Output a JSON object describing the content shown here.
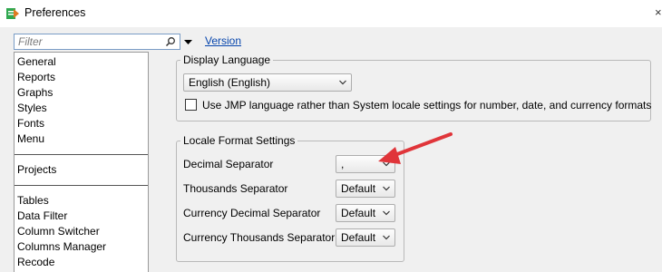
{
  "window": {
    "title": "Preferences",
    "close_glyph": "×"
  },
  "filter": {
    "placeholder": "Filter",
    "version_link": "Version"
  },
  "categories": {
    "group1": [
      "General",
      "Reports",
      "Graphs",
      "Styles",
      "Fonts",
      "Menu"
    ],
    "group2": [
      "Projects"
    ],
    "group3": [
      "Tables",
      "Data Filter",
      "Column Switcher",
      "Columns Manager",
      "Recode"
    ]
  },
  "display_language": {
    "legend": "Display Language",
    "selected": "English (English)",
    "checkbox_label": "Use JMP language rather than System locale settings for number, date, and currency formats",
    "checkbox_checked": false
  },
  "locale_format": {
    "legend": "Locale Format Settings",
    "rows": [
      {
        "label": "Decimal Separator",
        "value": ","
      },
      {
        "label": "Thousands Separator",
        "value": "Default"
      },
      {
        "label": "Currency Decimal Separator",
        "value": "Default"
      },
      {
        "label": "Currency Thousands Separator",
        "value": "Default"
      }
    ]
  },
  "colors": {
    "accent_link": "#0645ad",
    "annotation_arrow": "#e0353a",
    "app_icon_green": "#2fa84f"
  }
}
